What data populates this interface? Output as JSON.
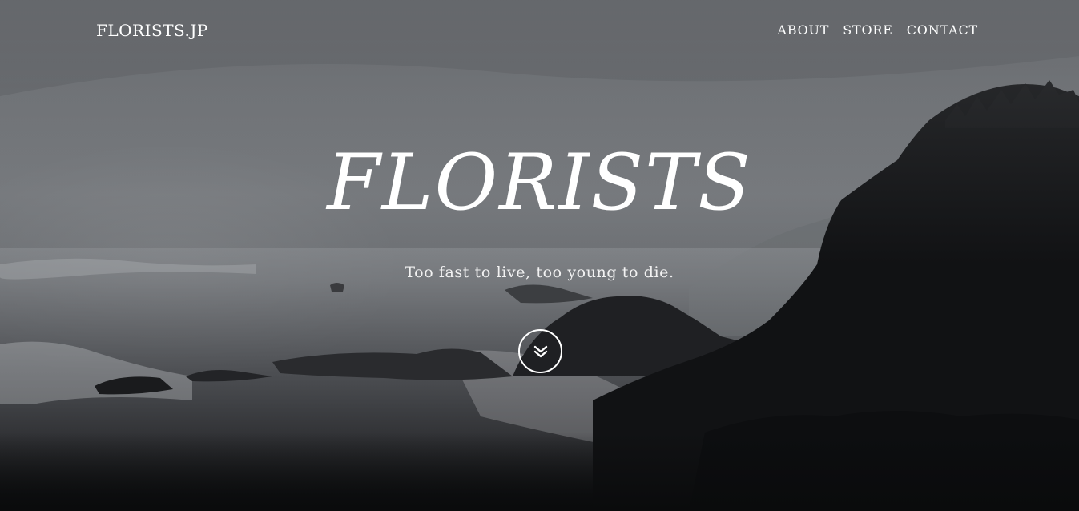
{
  "header": {
    "brand": "FLORISTS.JP",
    "nav": [
      "ABOUT",
      "STORE",
      "CONTACT"
    ]
  },
  "hero": {
    "title": "FLORISTS",
    "tagline": "Too fast to live, too young to die.",
    "scroll_icon": "chevron-double-down-icon"
  },
  "colors": {
    "text": "#ffffff",
    "sky": "#6b6e72",
    "rock": "#101113"
  }
}
